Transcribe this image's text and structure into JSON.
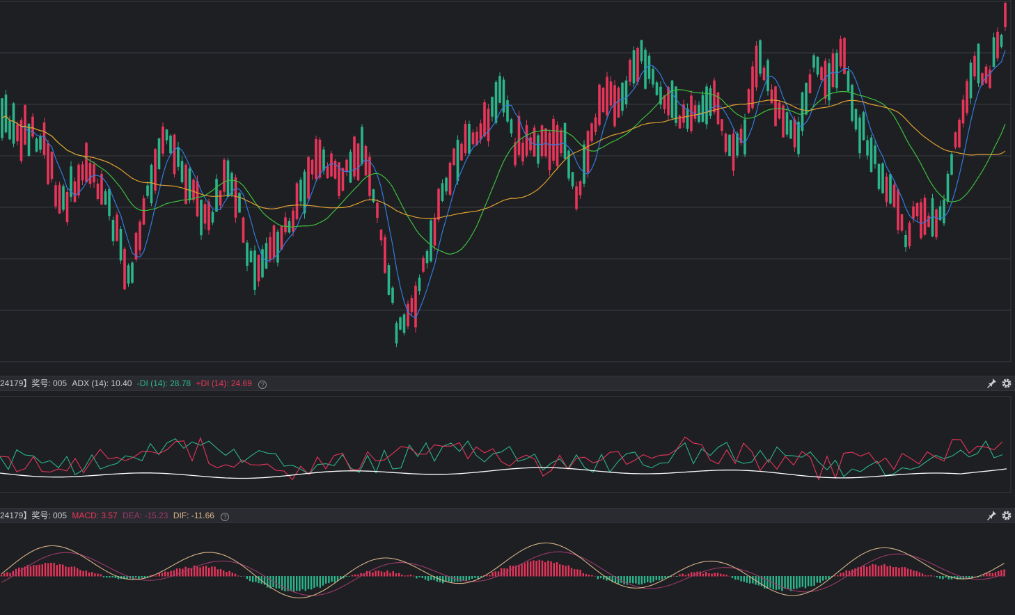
{
  "main_chart": {
    "chart_data": {
      "type": "candlestick",
      "title": "",
      "series": [
        {
          "name": "candles",
          "color_up": "#e8355a",
          "color_down": "#2bb58a"
        },
        {
          "name": "MA-fast",
          "color": "#2f7de1"
        },
        {
          "name": "MA-mid",
          "color": "#3fbf3f"
        },
        {
          "name": "MA-slow",
          "color": "#e0a030"
        }
      ],
      "grid": true,
      "legend": "none"
    }
  },
  "adx_bar": {
    "code": "24179】奖号: 005",
    "adx_label": "ADX (14): 10.40",
    "minus_di_label": "-DI (14): 28.78",
    "plus_di_label": "+DI (14): 24.69",
    "minus_di_color": "#2bb58a",
    "plus_di_color": "#e8355a",
    "adx_color": "#ffffff"
  },
  "macd_bar": {
    "code": "24179】奖号: 005",
    "macd_label": "MACD: 3.57",
    "dea_label": "DEA: -15.23",
    "dif_label": "DIF: -11.66",
    "macd_color": "#e8355a",
    "dea_color": "#9a3a6a",
    "dif_color": "#d8b48a"
  },
  "icons": {
    "pin": "pin-icon",
    "settings": "gear-icon",
    "help": "help-icon"
  },
  "help_glyph": "?"
}
